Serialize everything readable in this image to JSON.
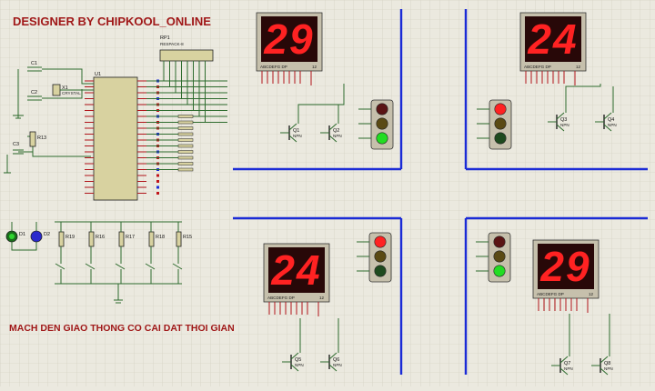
{
  "header": {
    "title": "DESIGNER BY CHIPKOOL_ONLINE"
  },
  "footer": {
    "caption": "MACH DEN GIAO THONG CO CAI DAT THOI GIAN"
  },
  "displays": [
    {
      "id": "north",
      "value": "29",
      "pins": "ABCDEFG DP",
      "pins2": "12"
    },
    {
      "id": "east",
      "value": "24",
      "pins": "ABCDEFG DP",
      "pins2": "12"
    },
    {
      "id": "west",
      "value": "24",
      "pins": "ABCDEFG DP",
      "pins2": "12"
    },
    {
      "id": "south",
      "value": "29",
      "pins": "ABCDEFG DP",
      "pins2": "12"
    }
  ],
  "traffic_lights": [
    {
      "id": "north",
      "lit": "green",
      "colors": {
        "red": "#5a1414",
        "yellow": "#5a4a14",
        "green": "#22dd22"
      }
    },
    {
      "id": "east",
      "lit": "red",
      "colors": {
        "red": "#ff2222",
        "yellow": "#5a4a14",
        "green": "#1e4a1e"
      }
    },
    {
      "id": "west",
      "lit": "red",
      "colors": {
        "red": "#ff2222",
        "yellow": "#5a4a14",
        "green": "#1e4a1e"
      }
    },
    {
      "id": "south",
      "lit": "green",
      "colors": {
        "red": "#5a1414",
        "yellow": "#5a4a14",
        "green": "#22dd22"
      }
    }
  ],
  "mcu": {
    "ref": "U1"
  },
  "resistor_pack": {
    "ref": "RP1",
    "value": "RESPACK-8"
  },
  "crystal": {
    "ref": "X1",
    "value": "CRYSTAL"
  },
  "caps": [
    {
      "ref": "C1"
    },
    {
      "ref": "C2"
    },
    {
      "ref": "C3"
    }
  ],
  "resistors": [
    "R13",
    "R19",
    "R16",
    "R17",
    "R18",
    "R15"
  ],
  "leds": [
    "D1",
    "D2"
  ],
  "transistors": [
    {
      "ref": "Q1",
      "type": "NPN"
    },
    {
      "ref": "Q2",
      "type": "NPN"
    },
    {
      "ref": "Q3",
      "type": "NPN"
    },
    {
      "ref": "Q4",
      "type": "NPN"
    },
    {
      "ref": "Q5",
      "type": "NPN"
    },
    {
      "ref": "Q6",
      "type": "NPN"
    },
    {
      "ref": "Q7",
      "type": "NPN"
    },
    {
      "ref": "Q8",
      "type": "NPN"
    }
  ]
}
